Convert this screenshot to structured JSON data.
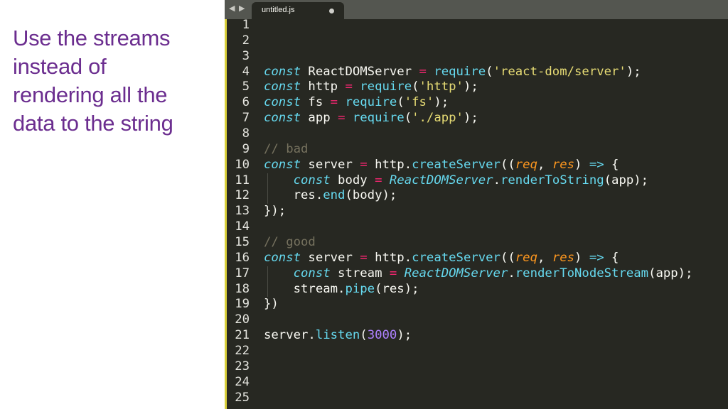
{
  "slide": {
    "lines": [
      "Use the streams",
      "instead of",
      "rendering all the",
      "data to the string"
    ]
  },
  "editor": {
    "tab_title": "untitled.js",
    "nav_back": "◀",
    "nav_forward": "▶",
    "line_numbers": [
      "1",
      "2",
      "3",
      "4",
      "5",
      "6",
      "7",
      "8",
      "9",
      "10",
      "11",
      "12",
      "13",
      "14",
      "15",
      "16",
      "17",
      "18",
      "19",
      "20",
      "21",
      "22",
      "23",
      "24",
      "25"
    ],
    "code": [
      [],
      [],
      [],
      [
        [
          "kw",
          "const"
        ],
        [
          "id",
          " ReactDOMServer "
        ],
        [
          "op",
          "="
        ],
        [
          "id",
          " "
        ],
        [
          "fn",
          "require"
        ],
        [
          "id",
          "("
        ],
        [
          "str",
          "'react-dom/server'"
        ],
        [
          "id",
          ");"
        ]
      ],
      [
        [
          "kw",
          "const"
        ],
        [
          "id",
          " http "
        ],
        [
          "op",
          "="
        ],
        [
          "id",
          " "
        ],
        [
          "fn",
          "require"
        ],
        [
          "id",
          "("
        ],
        [
          "str",
          "'http'"
        ],
        [
          "id",
          ");"
        ]
      ],
      [
        [
          "kw",
          "const"
        ],
        [
          "id",
          " fs "
        ],
        [
          "op",
          "="
        ],
        [
          "id",
          " "
        ],
        [
          "fn",
          "require"
        ],
        [
          "id",
          "("
        ],
        [
          "str",
          "'fs'"
        ],
        [
          "id",
          ");"
        ]
      ],
      [
        [
          "kw",
          "const"
        ],
        [
          "id",
          " app "
        ],
        [
          "op",
          "="
        ],
        [
          "id",
          " "
        ],
        [
          "fn",
          "require"
        ],
        [
          "id",
          "("
        ],
        [
          "str",
          "'./app'"
        ],
        [
          "id",
          ");"
        ]
      ],
      [],
      [
        [
          "cmt",
          "// bad"
        ]
      ],
      [
        [
          "kw",
          "const"
        ],
        [
          "id",
          " server "
        ],
        [
          "op",
          "="
        ],
        [
          "id",
          " http."
        ],
        [
          "fn",
          "createServer"
        ],
        [
          "id",
          "(("
        ],
        [
          "prm",
          "req"
        ],
        [
          "id",
          ", "
        ],
        [
          "prm",
          "res"
        ],
        [
          "id",
          ") "
        ],
        [
          "kw",
          "=>"
        ],
        [
          "id",
          " {"
        ]
      ],
      [
        [
          "id",
          "    "
        ],
        [
          "kw",
          "const"
        ],
        [
          "id",
          " body "
        ],
        [
          "op",
          "="
        ],
        [
          "id",
          " "
        ],
        [
          "cls",
          "ReactDOMServer"
        ],
        [
          "id",
          "."
        ],
        [
          "fn",
          "renderToString"
        ],
        [
          "id",
          "(app);"
        ]
      ],
      [
        [
          "id",
          "    res."
        ],
        [
          "fn",
          "end"
        ],
        [
          "id",
          "(body);"
        ]
      ],
      [
        [
          "id",
          "});"
        ]
      ],
      [],
      [
        [
          "cmt",
          "// good"
        ]
      ],
      [
        [
          "kw",
          "const"
        ],
        [
          "id",
          " server "
        ],
        [
          "op",
          "="
        ],
        [
          "id",
          " http."
        ],
        [
          "fn",
          "createServer"
        ],
        [
          "id",
          "(("
        ],
        [
          "prm",
          "req"
        ],
        [
          "id",
          ", "
        ],
        [
          "prm",
          "res"
        ],
        [
          "id",
          ") "
        ],
        [
          "kw",
          "=>"
        ],
        [
          "id",
          " {"
        ]
      ],
      [
        [
          "id",
          "    "
        ],
        [
          "kw",
          "const"
        ],
        [
          "id",
          " stream "
        ],
        [
          "op",
          "="
        ],
        [
          "id",
          " "
        ],
        [
          "cls",
          "ReactDOMServer"
        ],
        [
          "id",
          "."
        ],
        [
          "fn",
          "renderToNodeStream"
        ],
        [
          "id",
          "(app);"
        ]
      ],
      [
        [
          "id",
          "    stream."
        ],
        [
          "fn",
          "pipe"
        ],
        [
          "id",
          "(res);"
        ]
      ],
      [
        [
          "id",
          "})"
        ]
      ],
      [],
      [
        [
          "id",
          "server."
        ],
        [
          "fn",
          "listen"
        ],
        [
          "id",
          "("
        ],
        [
          "num",
          "3000"
        ],
        [
          "id",
          ");"
        ]
      ],
      [],
      [],
      [],
      []
    ],
    "colors": {
      "background": "#272822",
      "tabbar": "#545650",
      "keyword": "#66d9ef",
      "operator": "#f92672",
      "string": "#e6db74",
      "param": "#fd971f",
      "number": "#ae81ff",
      "comment": "#75715e",
      "slide_text": "#6b2d8f"
    }
  }
}
